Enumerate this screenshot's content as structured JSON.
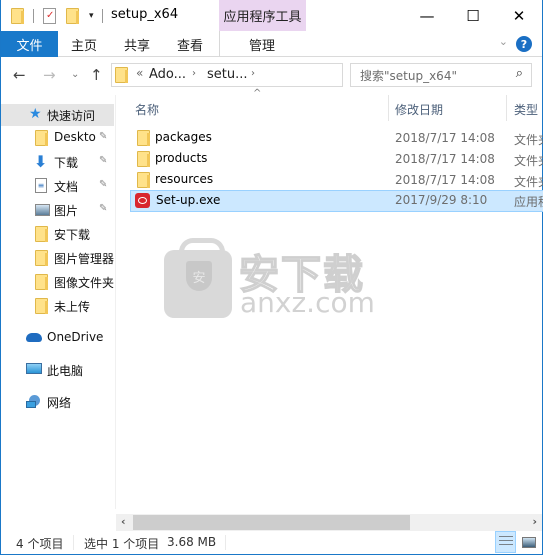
{
  "window": {
    "title": "setup_x64",
    "contextual_tab_group": "应用程序工具",
    "controls": {
      "minimize": "—",
      "maximize": "☐",
      "close": "✕"
    }
  },
  "quick_access_toolbar": {
    "icons": [
      "folder-icon",
      "properties-icon",
      "new-folder-icon",
      "customize-dropdown-icon"
    ]
  },
  "ribbon": {
    "tabs": [
      {
        "label": "文件",
        "active": true
      },
      {
        "label": "主页"
      },
      {
        "label": "共享"
      },
      {
        "label": "查看"
      },
      {
        "label": "管理"
      }
    ],
    "help": "?",
    "expand": "⌄"
  },
  "navigation": {
    "back": "←",
    "forward": "→",
    "recent": "⌄",
    "up": "↑",
    "address": {
      "overflow": "«",
      "crumbs": [
        "Ado...",
        "setu..."
      ],
      "separator": "›",
      "dropdown": "⌄",
      "refresh": "↻"
    },
    "search": {
      "placeholder": "搜索\"setup_x64\"",
      "icon": "⌕"
    }
  },
  "sidebar": {
    "items": [
      {
        "label": "快速访问",
        "icon": "star-icon",
        "active": true
      },
      {
        "label": "Deskto",
        "icon": "folder-icon",
        "pinned": true
      },
      {
        "label": "下载",
        "icon": "download-icon",
        "pinned": true
      },
      {
        "label": "文档",
        "icon": "document-icon",
        "pinned": true
      },
      {
        "label": "图片",
        "icon": "pictures-icon",
        "pinned": true
      },
      {
        "label": "安下载",
        "icon": "folder-icon"
      },
      {
        "label": "图片管理器",
        "icon": "folder-icon"
      },
      {
        "label": "图像文件夹",
        "icon": "folder-icon"
      },
      {
        "label": "未上传",
        "icon": "folder-icon"
      },
      {
        "label": "OneDrive",
        "icon": "cloud-icon"
      },
      {
        "label": "此电脑",
        "icon": "computer-icon"
      },
      {
        "label": "网络",
        "icon": "network-icon"
      }
    ],
    "pin_glyph": "📌"
  },
  "file_list": {
    "columns": [
      "名称",
      "修改日期",
      "类型"
    ],
    "sort_indicator": "^",
    "rows": [
      {
        "name": "packages",
        "date": "2018/7/17 14:08",
        "type": "文件夹",
        "icon": "folder-icon",
        "selected": false
      },
      {
        "name": "products",
        "date": "2018/7/17 14:08",
        "type": "文件夹",
        "icon": "folder-icon",
        "selected": false
      },
      {
        "name": "resources",
        "date": "2018/7/17 14:08",
        "type": "文件夹",
        "icon": "folder-icon",
        "selected": false
      },
      {
        "name": "Set-up.exe",
        "date": "2017/9/29 8:10",
        "type": "应用程序",
        "icon": "adobe-cc-icon",
        "selected": true
      }
    ]
  },
  "watermark": {
    "title": "安下载",
    "url": "anxz.com",
    "badge": "安"
  },
  "scrollbar": {
    "left": "‹",
    "right": "›"
  },
  "status_bar": {
    "item_count": "4 个项目",
    "selection": "选中 1 个项目",
    "size": "3.68 MB"
  },
  "view_buttons": [
    {
      "name": "details-view",
      "active": true
    },
    {
      "name": "large-icons-view",
      "active": false
    }
  ],
  "colors": {
    "accent": "#1979ca",
    "contextual_tab": "#ead5f0",
    "selection": "#cce8ff",
    "selection_border": "#99d1ff",
    "header_text": "#4c607a"
  }
}
